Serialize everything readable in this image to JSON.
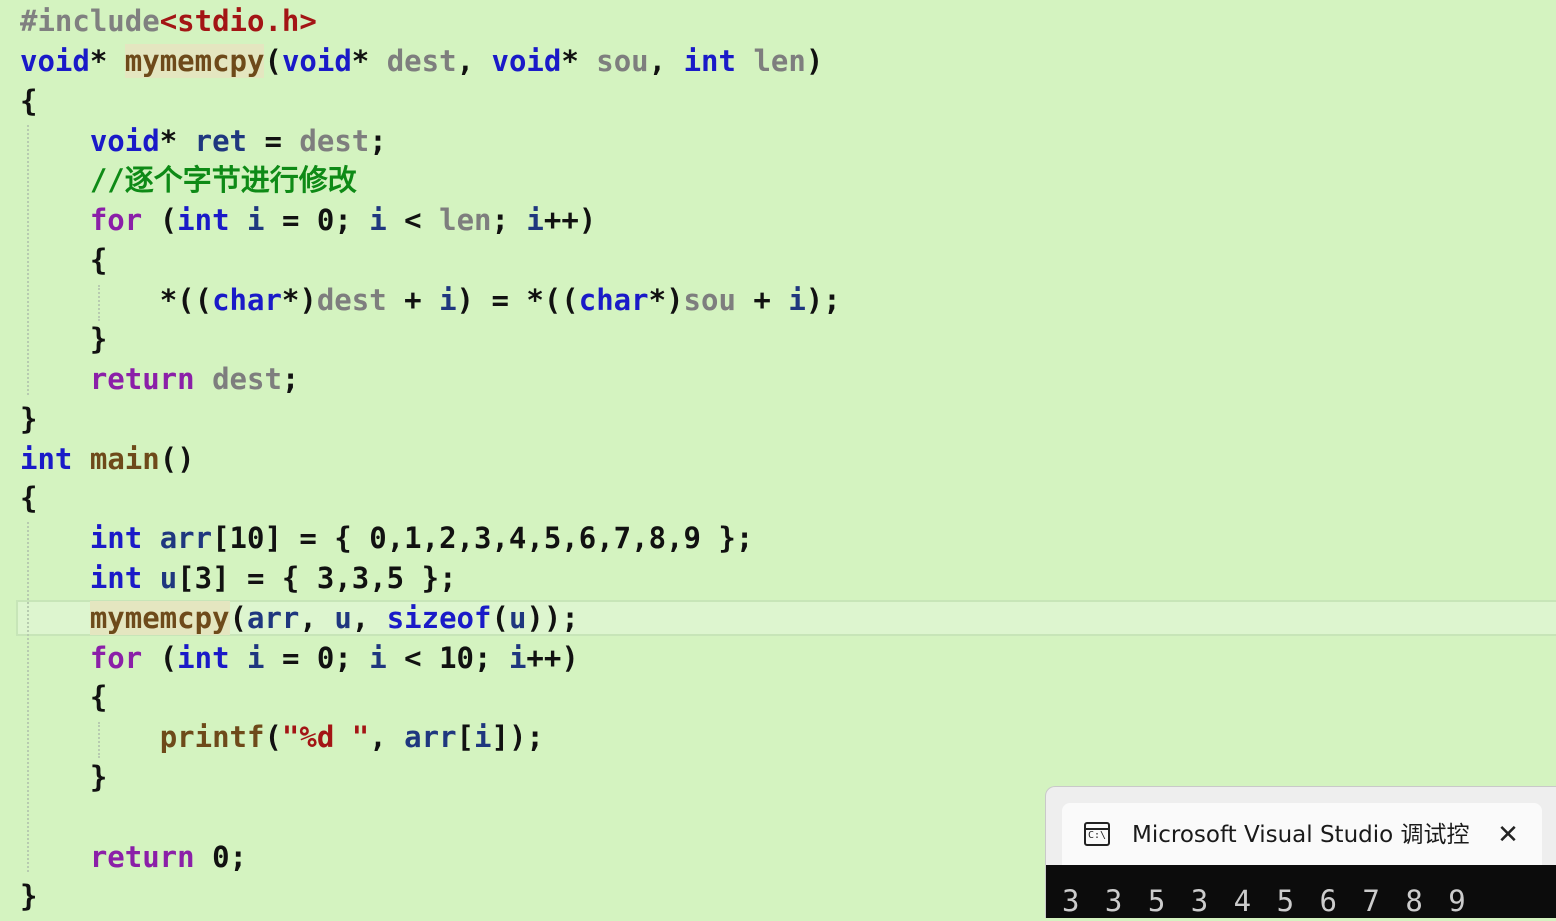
{
  "code": {
    "l1": [
      "#include",
      "<stdio.h>"
    ],
    "l2": [
      "void",
      "*",
      " ",
      "mymemcpy",
      "(",
      "void",
      "*",
      " ",
      "dest",
      ", ",
      "void",
      "*",
      " ",
      "sou",
      ", ",
      "int",
      " ",
      "len",
      ")"
    ],
    "l3": [
      "{"
    ],
    "l4": [
      "    ",
      "void",
      "*",
      " ",
      "ret",
      " = ",
      "dest",
      ";"
    ],
    "l5": [
      "    ",
      "//逐个字节进行修改"
    ],
    "l6": [
      "    ",
      "for",
      " (",
      "int",
      " ",
      "i",
      " = 0; ",
      "i",
      " < ",
      "len",
      "; ",
      "i",
      "++)"
    ],
    "l7": [
      "    ",
      "{"
    ],
    "l8": [
      "        ",
      "*((",
      "char",
      "*)",
      "dest",
      " + ",
      "i",
      ") = *((",
      "char",
      "*)",
      "sou",
      " + ",
      "i",
      ");"
    ],
    "l9": [
      "    ",
      "}"
    ],
    "l10": [
      "    ",
      "return",
      " ",
      "dest",
      ";"
    ],
    "l11": [
      "}"
    ],
    "l12": [
      "int",
      " ",
      "main",
      "()"
    ],
    "l13": [
      "{"
    ],
    "l14": [
      "    ",
      "int",
      " ",
      "arr",
      "[10] = { 0,1,2,3,4,5,6,7,8,9 };"
    ],
    "l15": [
      "    ",
      "int",
      " ",
      "u",
      "[3] = { 3,3,5 };"
    ],
    "l16": [
      "    ",
      "mymemcpy",
      "(",
      "arr",
      ", ",
      "u",
      ", ",
      "sizeof",
      "(",
      "u",
      "));"
    ],
    "l17": [
      "    ",
      "for",
      " (",
      "int",
      " ",
      "i",
      " = 0; ",
      "i",
      " < 10; ",
      "i",
      "++)"
    ],
    "l18": [
      "    ",
      "{"
    ],
    "l19": [
      "        ",
      "printf",
      "(",
      "\"%d \"",
      ", ",
      "arr",
      "[",
      "i",
      "]);"
    ],
    "l20": [
      "    ",
      "}"
    ],
    "l21": [
      ""
    ],
    "l22": [
      "    ",
      "return",
      " 0;"
    ],
    "l23": [
      "}"
    ]
  },
  "console": {
    "title": "Microsoft Visual Studio 调试控",
    "icon": "console-window-icon",
    "icon_text": "C:\\",
    "close": "✕",
    "output": "3 3 5 3 4 5 6 7 8 9"
  },
  "colors": {
    "background": "#d4f3c0",
    "keyword": "#1a1ac8",
    "control": "#8b1fa8",
    "function": "#6e4a1a",
    "parameter": "#7e7e7e",
    "local": "#1f377f",
    "comment": "#0e8a16",
    "string": "#a31515"
  }
}
